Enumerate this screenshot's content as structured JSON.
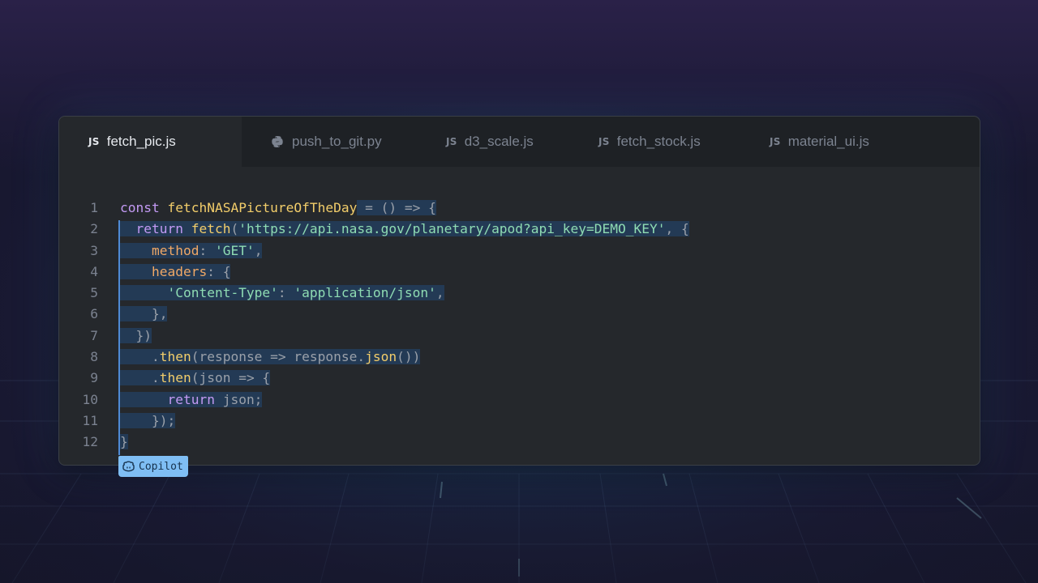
{
  "tabs": [
    {
      "label": "fetch_pic.js",
      "badge": "JS",
      "active": true
    },
    {
      "label": "push_to_git.py",
      "badge": "python-icon",
      "active": false
    },
    {
      "label": "d3_scale.js",
      "badge": "JS",
      "active": false
    },
    {
      "label": "fetch_stock.js",
      "badge": "JS",
      "active": false
    },
    {
      "label": "material_ui.js",
      "badge": "JS",
      "active": false
    }
  ],
  "code": {
    "line_numbers": [
      "1",
      "2",
      "3",
      "4",
      "5",
      "6",
      "7",
      "8",
      "9",
      "10",
      "11",
      "12"
    ],
    "lines": [
      {
        "tokens": [
          [
            "kw",
            "const "
          ],
          [
            "fn",
            "fetchNASAPictureOfTheDay"
          ],
          [
            "op",
            " = () => {"
          ]
        ]
      },
      {
        "tokens": [
          [
            "kw",
            "  return "
          ],
          [
            "fn",
            "fetch"
          ],
          [
            "op",
            "("
          ],
          [
            "str",
            "'https://api.nasa.gov/planetary/apod?api_key=DEMO_KEY'"
          ],
          [
            "op",
            ", {"
          ]
        ]
      },
      {
        "tokens": [
          [
            "prop",
            "    method"
          ],
          [
            "op",
            ": "
          ],
          [
            "str",
            "'GET'"
          ],
          [
            "op",
            ","
          ]
        ]
      },
      {
        "tokens": [
          [
            "prop",
            "    headers"
          ],
          [
            "op",
            ": {"
          ]
        ]
      },
      {
        "tokens": [
          [
            "str",
            "      'Content-Type'"
          ],
          [
            "op",
            ": "
          ],
          [
            "str",
            "'application/json'"
          ],
          [
            "op",
            ","
          ]
        ]
      },
      {
        "tokens": [
          [
            "op",
            "    },"
          ]
        ]
      },
      {
        "tokens": [
          [
            "op",
            "  })"
          ]
        ]
      },
      {
        "tokens": [
          [
            "op",
            "    ."
          ],
          [
            "fn",
            "then"
          ],
          [
            "op",
            "(response => response."
          ],
          [
            "fn",
            "json"
          ],
          [
            "op",
            "())"
          ]
        ]
      },
      {
        "tokens": [
          [
            "op",
            "    ."
          ],
          [
            "fn",
            "then"
          ],
          [
            "op",
            "(json => {"
          ]
        ]
      },
      {
        "tokens": [
          [
            "kw",
            "      return "
          ],
          [
            "op",
            "json;"
          ]
        ]
      },
      {
        "tokens": [
          [
            "op",
            "    });"
          ]
        ]
      },
      {
        "tokens": [
          [
            "op",
            "}"
          ]
        ]
      }
    ]
  },
  "copilot": {
    "label": "Copilot",
    "icon": "copilot-icon"
  },
  "colors": {
    "keyword": "#c39af4",
    "function": "#f2cd6a",
    "string": "#8fdcb3",
    "property": "#f0a866",
    "operator": "#9aa0a9",
    "selection": "#233a55",
    "accent": "#7fbef4"
  }
}
